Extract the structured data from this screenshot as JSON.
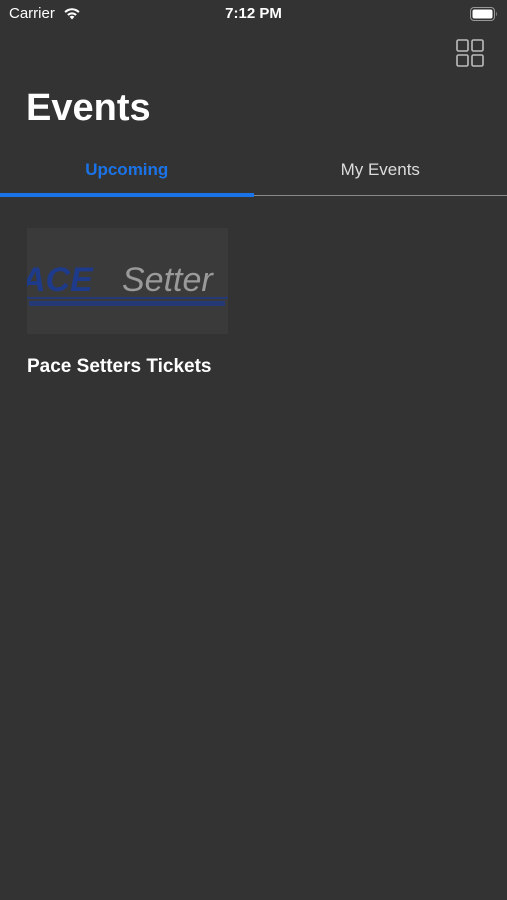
{
  "status_bar": {
    "carrier": "Carrier",
    "time": "7:12 PM"
  },
  "header": {
    "title": "Events",
    "grid_icon": "grid-icon"
  },
  "tabs": [
    {
      "label": "Upcoming",
      "selected": true
    },
    {
      "label": "My Events",
      "selected": false
    }
  ],
  "events": [
    {
      "title": "Pace Setters Tickets",
      "logo": {
        "text_bold": "ACE",
        "text_light": "Setter"
      }
    }
  ],
  "colors": {
    "background": "#333333",
    "accent": "#1a73e8",
    "text": "#ffffff",
    "inactive_tab": "#dcdcdc",
    "logo_blue": "#1e3a8a"
  }
}
